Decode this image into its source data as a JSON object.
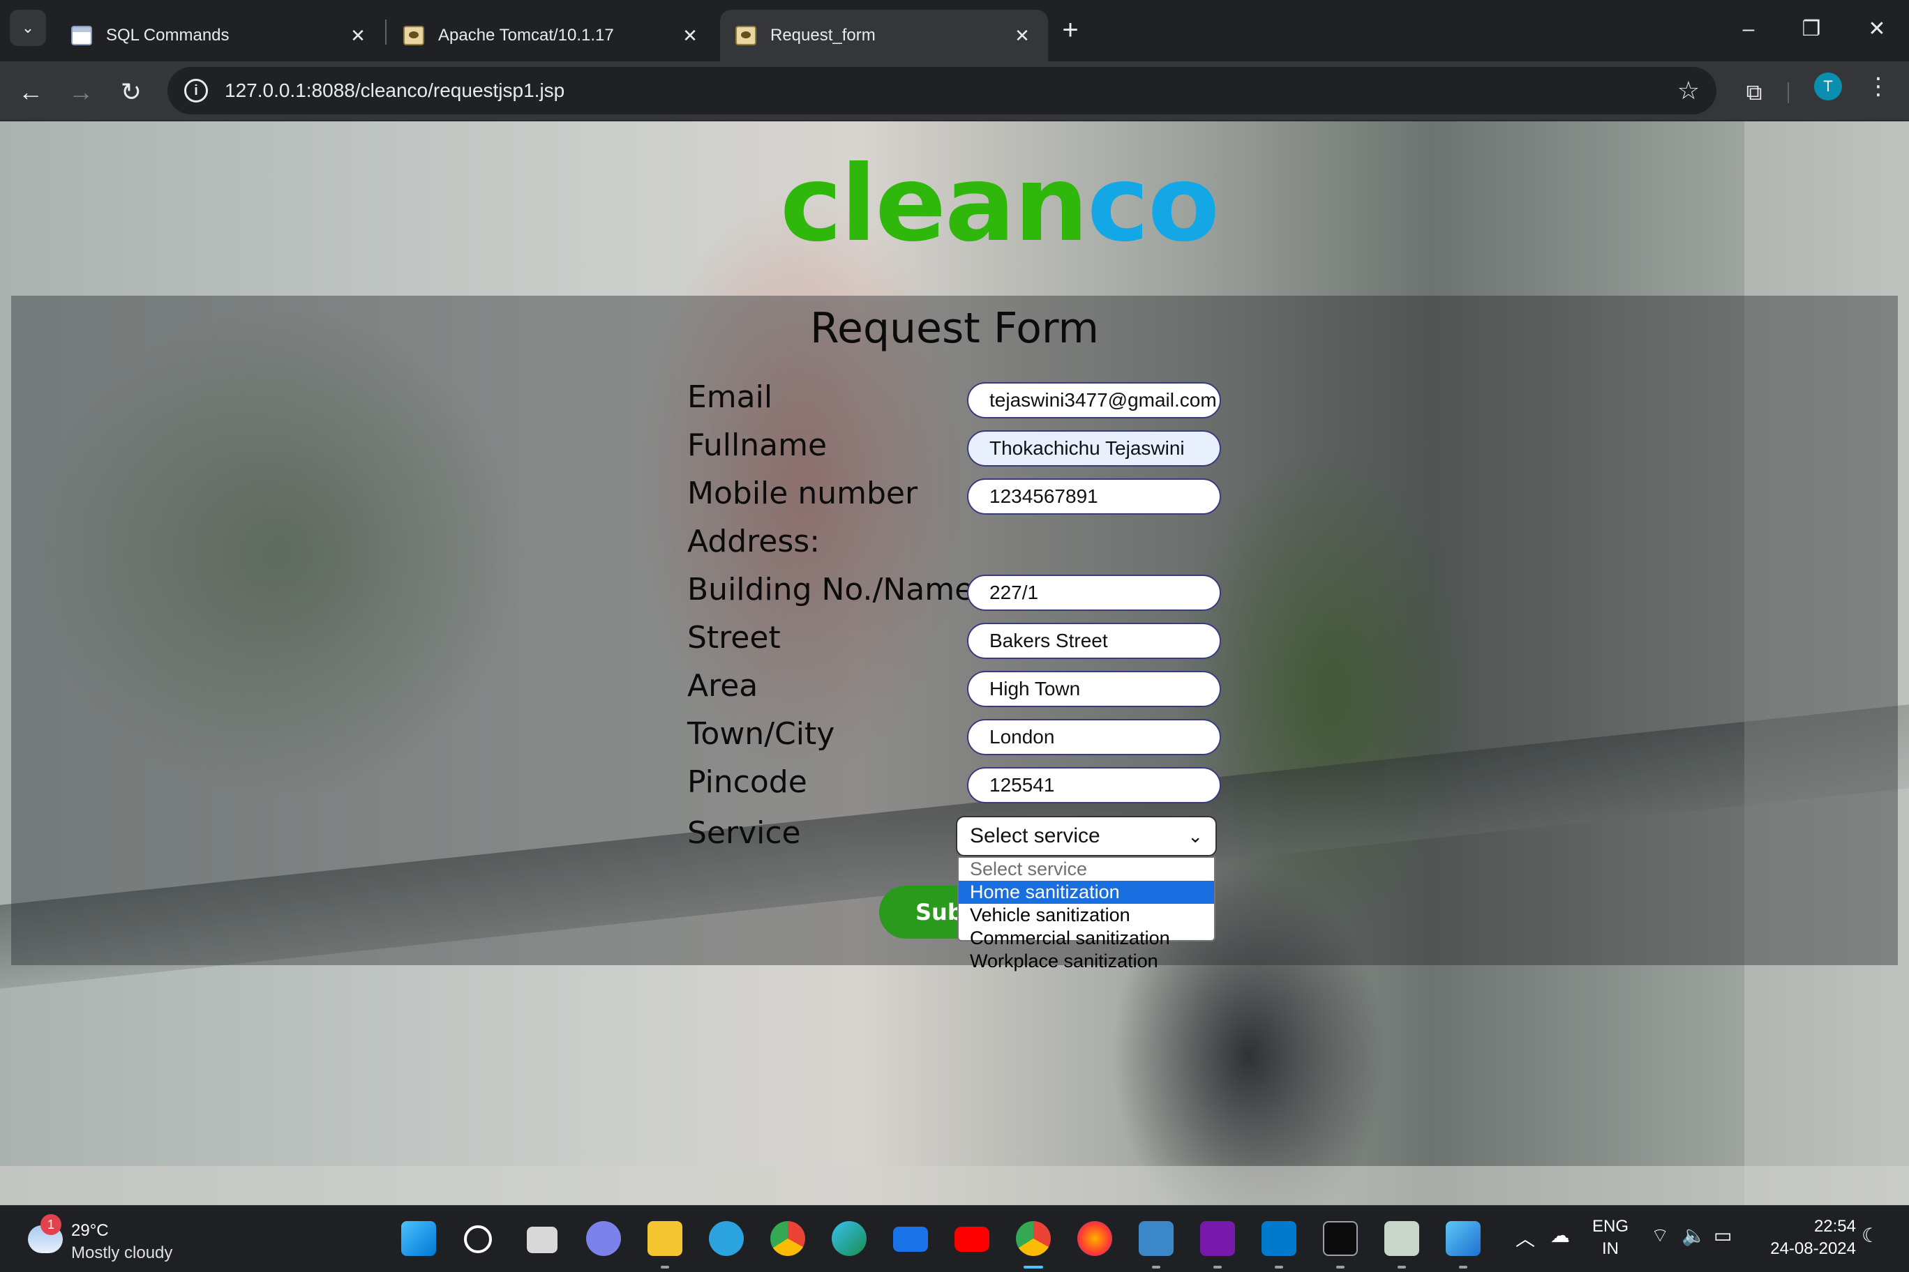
{
  "browser": {
    "tabs": [
      {
        "title": "SQL Commands",
        "icon": "sql-page-icon",
        "active": false
      },
      {
        "title": "Apache Tomcat/10.1.17",
        "icon": "tomcat-icon",
        "active": false
      },
      {
        "title": "Request_form",
        "icon": "tomcat-icon",
        "active": true
      }
    ],
    "url": "127.0.0.1:8088/cleanco/requestjsp1.jsp",
    "profile_initial": "T"
  },
  "page": {
    "logo": {
      "part1": "clean",
      "part2": "co",
      "color1": "#2fb80b",
      "color2": "#13a7e6"
    },
    "form_title": "Request Form",
    "fields": [
      {
        "label": "Email",
        "value": "tejaswini3477@gmail.com"
      },
      {
        "label": "Fullname",
        "value": "Thokachichu Tejaswini"
      },
      {
        "label": "Mobile number",
        "value": "1234567891"
      },
      {
        "label": "Address:",
        "value": null
      },
      {
        "label": "Building No./Name",
        "value": "227/1"
      },
      {
        "label": "Street",
        "value": "Bakers Street"
      },
      {
        "label": "Area",
        "value": "High Town"
      },
      {
        "label": "Town/City",
        "value": "London"
      },
      {
        "label": "Pincode",
        "value": "125541"
      }
    ],
    "service": {
      "label": "Service",
      "selected": "Select service",
      "options": [
        "Select service",
        "Home sanitization",
        "Vehicle sanitization",
        "Commercial sanitization",
        "Workplace sanitization"
      ],
      "highlighted_index": 1
    },
    "submit_label": "Submit"
  },
  "taskbar": {
    "weather": {
      "temp": "29°C",
      "condition": "Mostly cloudy",
      "badge": "1"
    },
    "tray": {
      "language": "ENG",
      "region": "IN"
    },
    "clock": {
      "time": "22:54",
      "date": "24-08-2024"
    }
  }
}
